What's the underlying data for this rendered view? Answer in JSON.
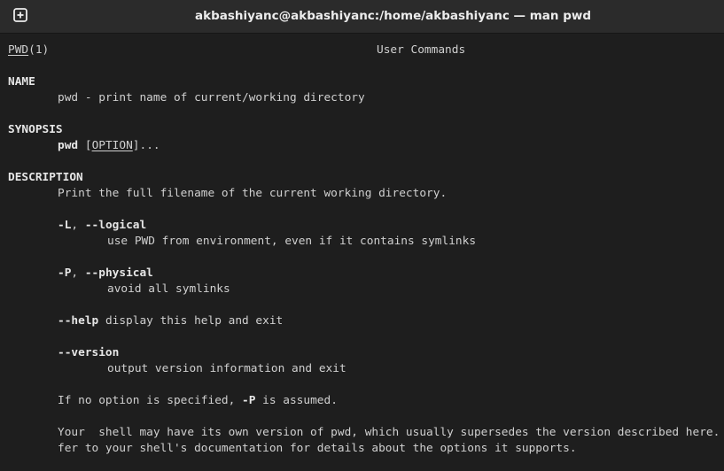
{
  "window": {
    "title": "akbashiyanc@akbashiyanc:/home/akbashiyanc — man pwd",
    "new_tab_icon": "new-tab-plus-icon"
  },
  "header": {
    "page": "PWD",
    "section": "(1)",
    "center": "User Commands"
  },
  "name_section": {
    "heading": "NAME",
    "text": "pwd - print name of current/working directory"
  },
  "synopsis_section": {
    "heading": "SYNOPSIS",
    "command": "pwd",
    "open_bracket": "[",
    "option": "OPTION",
    "close_rest": "]..."
  },
  "description_section": {
    "heading": "DESCRIPTION",
    "intro": "Print the full filename of the current working directory.",
    "options": {
      "logical_short": "-L",
      "logical_sep": ", ",
      "logical_long": "--logical",
      "logical_desc": "use PWD from environment, even if it contains symlinks",
      "physical_short": "-P",
      "physical_sep": ", ",
      "physical_long": "--physical",
      "physical_desc": "avoid all symlinks",
      "help_flag": "--help",
      "help_desc": " display this help and exit",
      "version_flag": "--version",
      "version_desc": "output version information and exit"
    },
    "default_note_pre": "If no option is specified, ",
    "default_note_flag": "-P",
    "default_note_post": " is assumed.",
    "shell_note_line1": "Your  shell may have its own version of pwd, which usually supersedes the version described here.  Please re-",
    "shell_note_line2": "fer to your shell's documentation for details about the options it supports."
  }
}
